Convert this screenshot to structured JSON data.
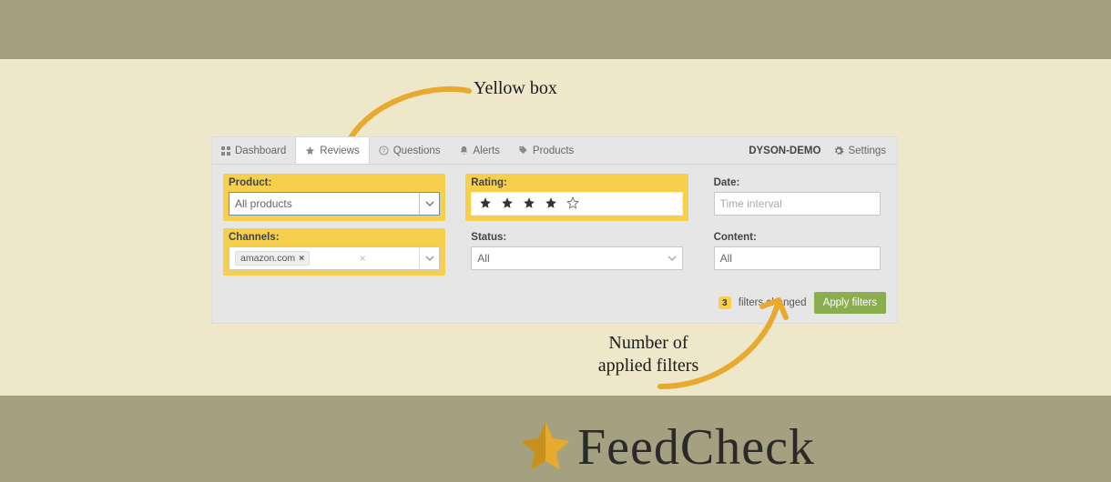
{
  "annotations": {
    "yellow_box": "Yellow box",
    "num_filters_line1": "Number of",
    "num_filters_line2": "applied filters"
  },
  "tabs": {
    "dashboard": "Dashboard",
    "reviews": "Reviews",
    "questions": "Questions",
    "alerts": "Alerts",
    "products": "Products"
  },
  "header": {
    "account": "DYSON-DEMO",
    "settings": "Settings"
  },
  "filters": {
    "product": {
      "label": "Product:",
      "value": "All products"
    },
    "channels": {
      "label": "Channels:",
      "chip": "amazon.com"
    },
    "rating": {
      "label": "Rating:",
      "filled": 4,
      "total": 5
    },
    "status": {
      "label": "Status:",
      "value": "All"
    },
    "date": {
      "label": "Date:",
      "placeholder": "Time interval"
    },
    "content": {
      "label": "Content:",
      "value": "All"
    }
  },
  "footer": {
    "changed_count": "3",
    "changed_label": "filters changed",
    "apply": "Apply filters"
  },
  "brand": {
    "name": "FeedCheck"
  },
  "colors": {
    "highlight": "#f6cf4d",
    "accent": "#e8a92f",
    "button": "#8aad4f"
  }
}
